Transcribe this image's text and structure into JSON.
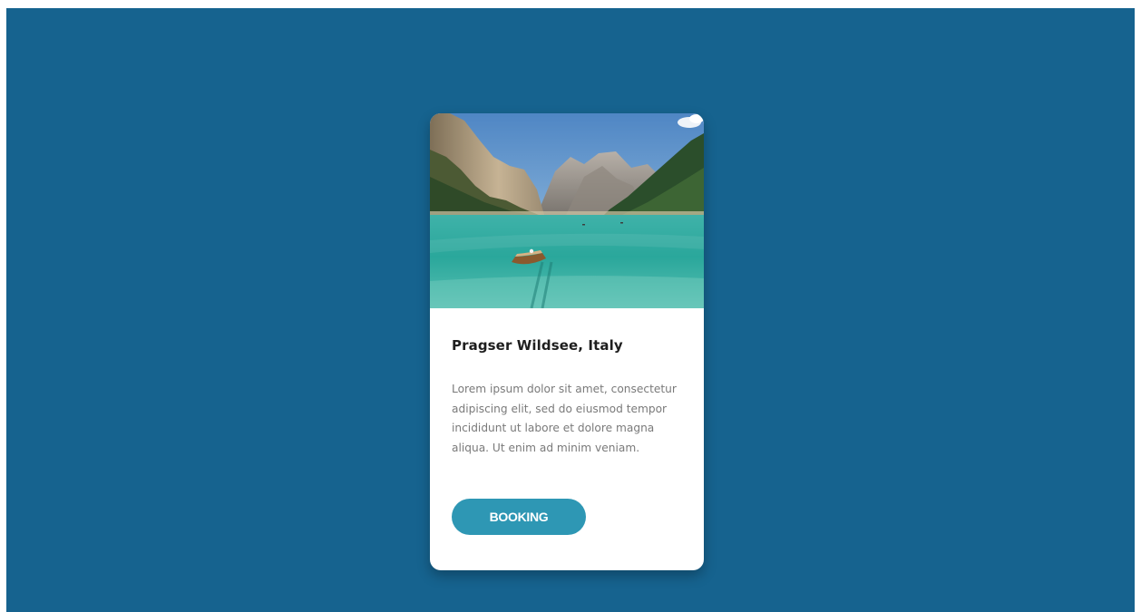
{
  "card": {
    "image_label": "Lake with mountains and a rowing boat",
    "title": "Pragser Wildsee, Italy",
    "description": "Lorem ipsum dolor sit amet, consectetur adipiscing elit, sed do eiusmod tempor incididunt ut labore et dolore magna aliqua. Ut enim ad minim veniam.",
    "button_label": "BOOKING"
  },
  "colors": {
    "background": "#16638f",
    "card": "#ffffff",
    "button": "#2e97b4",
    "title": "#1e1e1e",
    "text": "#7a7a7a"
  }
}
